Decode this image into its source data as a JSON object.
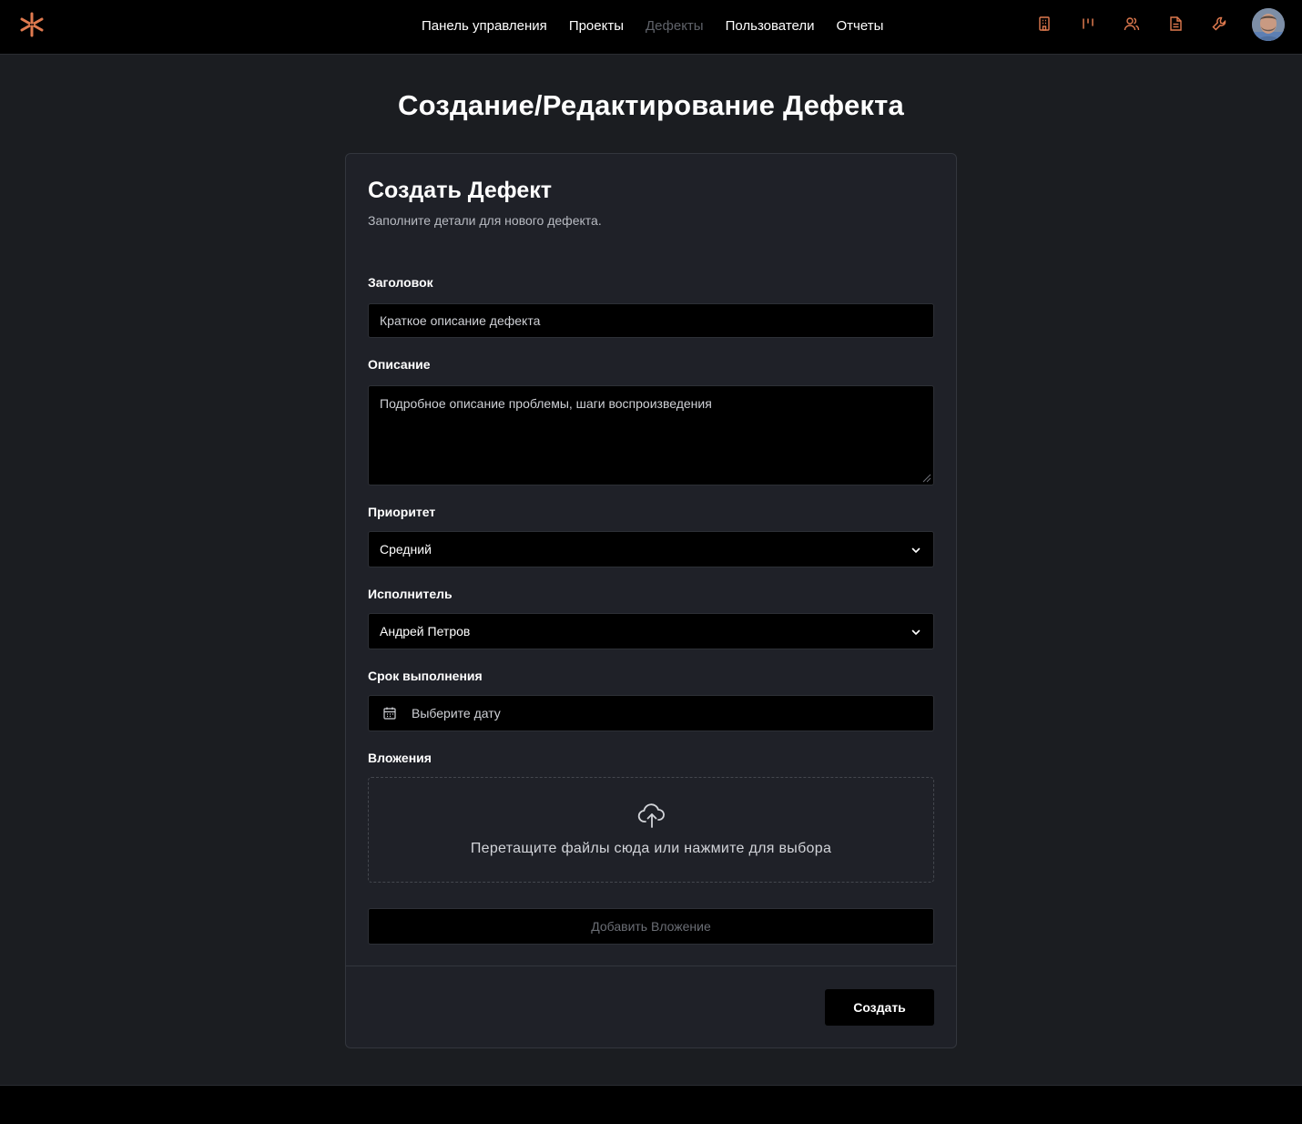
{
  "nav": {
    "items": [
      {
        "label": "Панель управления",
        "active": false
      },
      {
        "label": "Проекты",
        "active": false
      },
      {
        "label": "Дефекты",
        "active": true
      },
      {
        "label": "Пользователи",
        "active": false
      },
      {
        "label": "Отчеты",
        "active": false
      }
    ],
    "icons": [
      "building-icon",
      "kanban-icon",
      "users-icon",
      "document-icon",
      "wrench-icon"
    ],
    "accent_color": "#e07a4f"
  },
  "page": {
    "title": "Создание/Редактирование Дефекта"
  },
  "form": {
    "title": "Создать Дефект",
    "subtitle": "Заполните детали для нового дефекта.",
    "title_label": "Заголовок",
    "title_placeholder": "Краткое описание дефекта",
    "description_label": "Описание",
    "description_placeholder": "Подробное описание проблемы, шаги воспроизведения",
    "priority_label": "Приоритет",
    "priority_value": "Средний",
    "assignee_label": "Исполнитель",
    "assignee_value": "Андрей Петров",
    "due_label": "Срок выполнения",
    "due_placeholder": "Выберите дату",
    "attachments_label": "Вложения",
    "dropzone_text": "Перетащите файлы сюда или нажмите для выбора",
    "add_attachment_label": "Добавить Вложение",
    "submit_label": "Создать"
  }
}
